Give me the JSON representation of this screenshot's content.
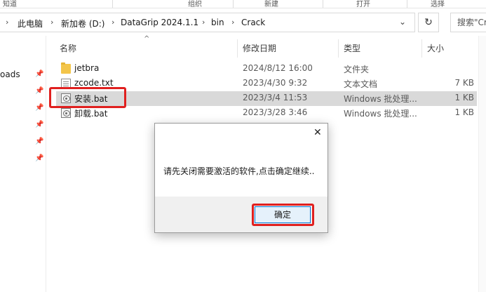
{
  "ribbon": {
    "items": [
      "知道",
      "组织",
      "新建",
      "打开",
      "选择"
    ]
  },
  "address": {
    "crumbs": [
      "此电脑",
      "新加卷 (D:)",
      "DataGrip 2024.1.1",
      "bin",
      "Crack"
    ],
    "separator": "›",
    "dropdown_icon": "chevron-down-icon",
    "refresh_icon": "refresh-icon",
    "search_placeholder": "搜索\"Crack\""
  },
  "nav": {
    "partial_label": "oads"
  },
  "columns": {
    "name": "名称",
    "date": "修改日期",
    "type": "类型",
    "size": "大小"
  },
  "files": [
    {
      "name": "jetbra",
      "date": "2024/8/12 16:00",
      "type": "文件夹",
      "size": "",
      "icon": "folder-icon"
    },
    {
      "name": "zcode.txt",
      "date": "2023/4/30 9:32",
      "type": "文本文档",
      "size": "7 KB",
      "icon": "text-file-icon"
    },
    {
      "name": "安装.bat",
      "date": "2023/3/4 11:53",
      "type": "Windows 批处理...",
      "size": "1 KB",
      "icon": "batch-file-icon",
      "selected": true
    },
    {
      "name": "卸载.bat",
      "date": "2023/3/28 3:46",
      "type": "Windows 批处理...",
      "size": "1 KB",
      "icon": "batch-file-icon"
    }
  ],
  "dialog": {
    "message": "请先关闭需要激活的软件,点击确定继续..",
    "ok_label": "确定",
    "close_glyph": "✕"
  },
  "colors": {
    "highlight": "#e0201f",
    "selected_row": "#d9d9d9",
    "button_border": "#0078d7"
  }
}
